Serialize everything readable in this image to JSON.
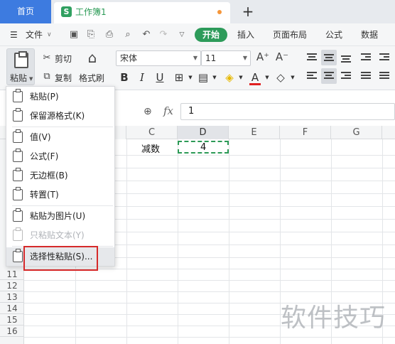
{
  "tabs": {
    "home": "首页",
    "doc_badge": "S",
    "doc_title": "工作簿1",
    "new_tab": "+"
  },
  "menubar": {
    "file": "文件",
    "start": "开始",
    "insert": "插入",
    "page_layout": "页面布局",
    "formula": "公式",
    "data": "数据"
  },
  "ribbon": {
    "paste": "粘贴",
    "cut": "剪切",
    "copy": "复制",
    "format_painter": "格式刷",
    "font_name": "宋体",
    "font_size": "11",
    "bold": "B",
    "italic": "I",
    "underline": "U",
    "increase_font": "A⁺",
    "decrease_font": "A⁻",
    "font_color_letter": "A"
  },
  "formula_bar": {
    "fx": "fx",
    "value": "1"
  },
  "grid": {
    "columns": [
      "C",
      "D",
      "E",
      "F",
      "G"
    ],
    "rows": [
      "11",
      "12",
      "13",
      "14",
      "15",
      "16"
    ],
    "cells": {
      "C2": "减数",
      "D2": "4"
    }
  },
  "paste_menu": {
    "items": [
      {
        "label": "粘贴(P)",
        "enabled": true
      },
      {
        "label": "保留源格式(K)",
        "enabled": true
      },
      {
        "label": "值(V)",
        "enabled": true
      },
      {
        "label": "公式(F)",
        "enabled": true
      },
      {
        "label": "无边框(B)",
        "enabled": true
      },
      {
        "label": "转置(T)",
        "enabled": true
      },
      {
        "label": "粘贴为图片(U)",
        "enabled": true
      },
      {
        "label": "只粘贴文本(Y)",
        "enabled": false
      },
      {
        "label": "选择性粘贴(S)...",
        "enabled": true
      }
    ]
  },
  "watermark": "软件技巧",
  "colors": {
    "home_tab": "#3d7be0",
    "accent_green": "#2d9b5a",
    "highlight_box": "#d62a2a"
  }
}
